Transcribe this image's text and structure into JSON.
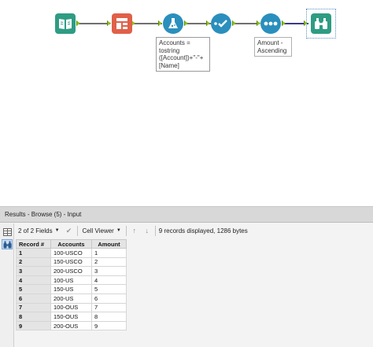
{
  "workflow": {
    "annotations": {
      "formula": "Accounts = tostring ([Account])+\"-\"+ [Name]",
      "sort": "Amount - Ascending"
    },
    "tools": [
      {
        "name": "input-icon",
        "color": "#2e9c83"
      },
      {
        "name": "text-to-columns-icon",
        "color": "#e06048"
      },
      {
        "name": "formula-icon",
        "color": "#2a8fbd"
      },
      {
        "name": "select-icon",
        "color": "#2a8fbd"
      },
      {
        "name": "sort-icon",
        "color": "#2a8fbd"
      },
      {
        "name": "browse-icon",
        "color": "#2e9c83"
      }
    ]
  },
  "results": {
    "title": "Results - Browse (5) - Input",
    "toolbar": {
      "fields_label": "2 of 2 Fields",
      "viewer_label": "Cell Viewer",
      "status": "9 records displayed, 1286 bytes"
    },
    "grid": {
      "headers": [
        "Record #",
        "Accounts",
        "Amount"
      ],
      "rows": [
        [
          "1",
          "100-USCO",
          "1"
        ],
        [
          "2",
          "150-USCO",
          "2"
        ],
        [
          "3",
          "200-USCO",
          "3"
        ],
        [
          "4",
          "100-US",
          "4"
        ],
        [
          "5",
          "150-US",
          "5"
        ],
        [
          "6",
          "200-US",
          "6"
        ],
        [
          "7",
          "100-OUS",
          "7"
        ],
        [
          "8",
          "150-OUS",
          "8"
        ],
        [
          "9",
          "200-OUS",
          "9"
        ]
      ]
    }
  }
}
